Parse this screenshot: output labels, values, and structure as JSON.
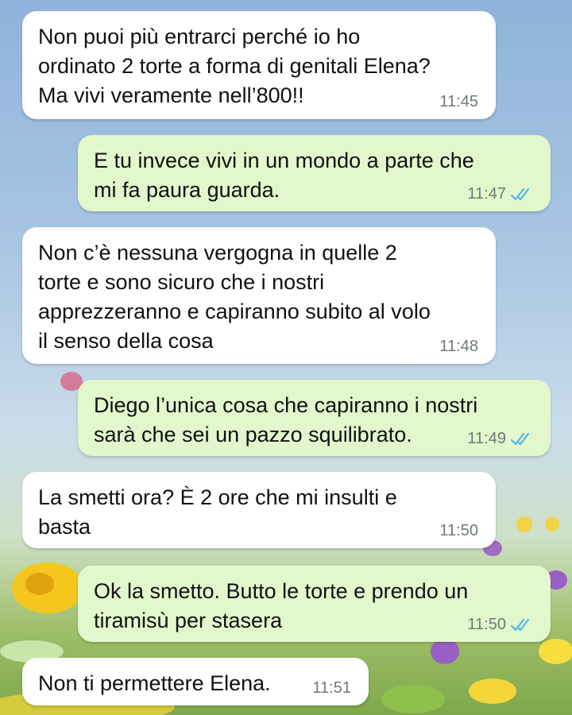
{
  "messages": [
    {
      "direction": "in",
      "text": "Non puoi più entrarci perché io ho\nordinato 2 torte a forma di genitali Elena?\nMa vivi veramente nell’800!!",
      "time": "11:45",
      "read": false
    },
    {
      "direction": "out",
      "text": "E tu invece vivi in un mondo a parte che\nmi fa paura guarda.",
      "time": "11:47",
      "read": true
    },
    {
      "direction": "in",
      "text": "Non c’è nessuna vergogna in quelle 2\ntorte e sono sicuro che i nostri\napprezzeranno e capiranno subito al volo\nil senso della cosa",
      "time": "11:48",
      "read": false
    },
    {
      "direction": "out",
      "text": "Diego l’unica cosa che capiranno i nostri\nsarà che sei un pazzo squilibrato.",
      "time": "11:49",
      "read": true
    },
    {
      "direction": "in",
      "text": "La smetti ora? È 2 ore che mi insulti e\nbasta",
      "time": "11:50",
      "read": false
    },
    {
      "direction": "out",
      "text": "Ok la smetto. Butto le torte e prendo un\ntiramisù per stasera",
      "time": "11:50",
      "read": true
    },
    {
      "direction": "in",
      "text": "Non ti permettere Elena.",
      "time": "11:51",
      "read": false
    }
  ],
  "colors": {
    "incoming_bubble": "#ffffff",
    "outgoing_bubble": "#e2f7cb",
    "read_ticks": "#4fb6ec",
    "timestamp": "#6f7a73"
  }
}
